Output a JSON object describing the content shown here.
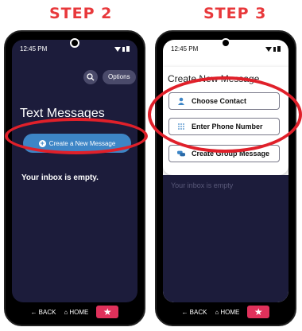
{
  "steps": {
    "left": "STEP 2",
    "right": "STEP 3"
  },
  "left_phone": {
    "time": "12:45 PM",
    "options_label": "Options",
    "heading": "Text Messages",
    "create_label": "Create a New Message",
    "empty_text": "Your inbox is empty."
  },
  "right_phone": {
    "time": "12:45 PM",
    "sheet_title": "Create New Message",
    "menu": [
      {
        "label": "Choose Contact",
        "icon": "person-icon"
      },
      {
        "label": "Enter Phone Number",
        "icon": "dialpad-icon"
      },
      {
        "label": "Create Group Message",
        "icon": "group-chat-icon"
      }
    ],
    "empty_text": "Your inbox is empty"
  },
  "nav": {
    "back": "BACK",
    "home": "HOME"
  },
  "colors": {
    "accent_red": "#e8383b",
    "highlight": "#e0202a",
    "screen_bg": "#1c1c3b",
    "button_blue": "#3d85c6",
    "star_pink": "#e0315b"
  }
}
